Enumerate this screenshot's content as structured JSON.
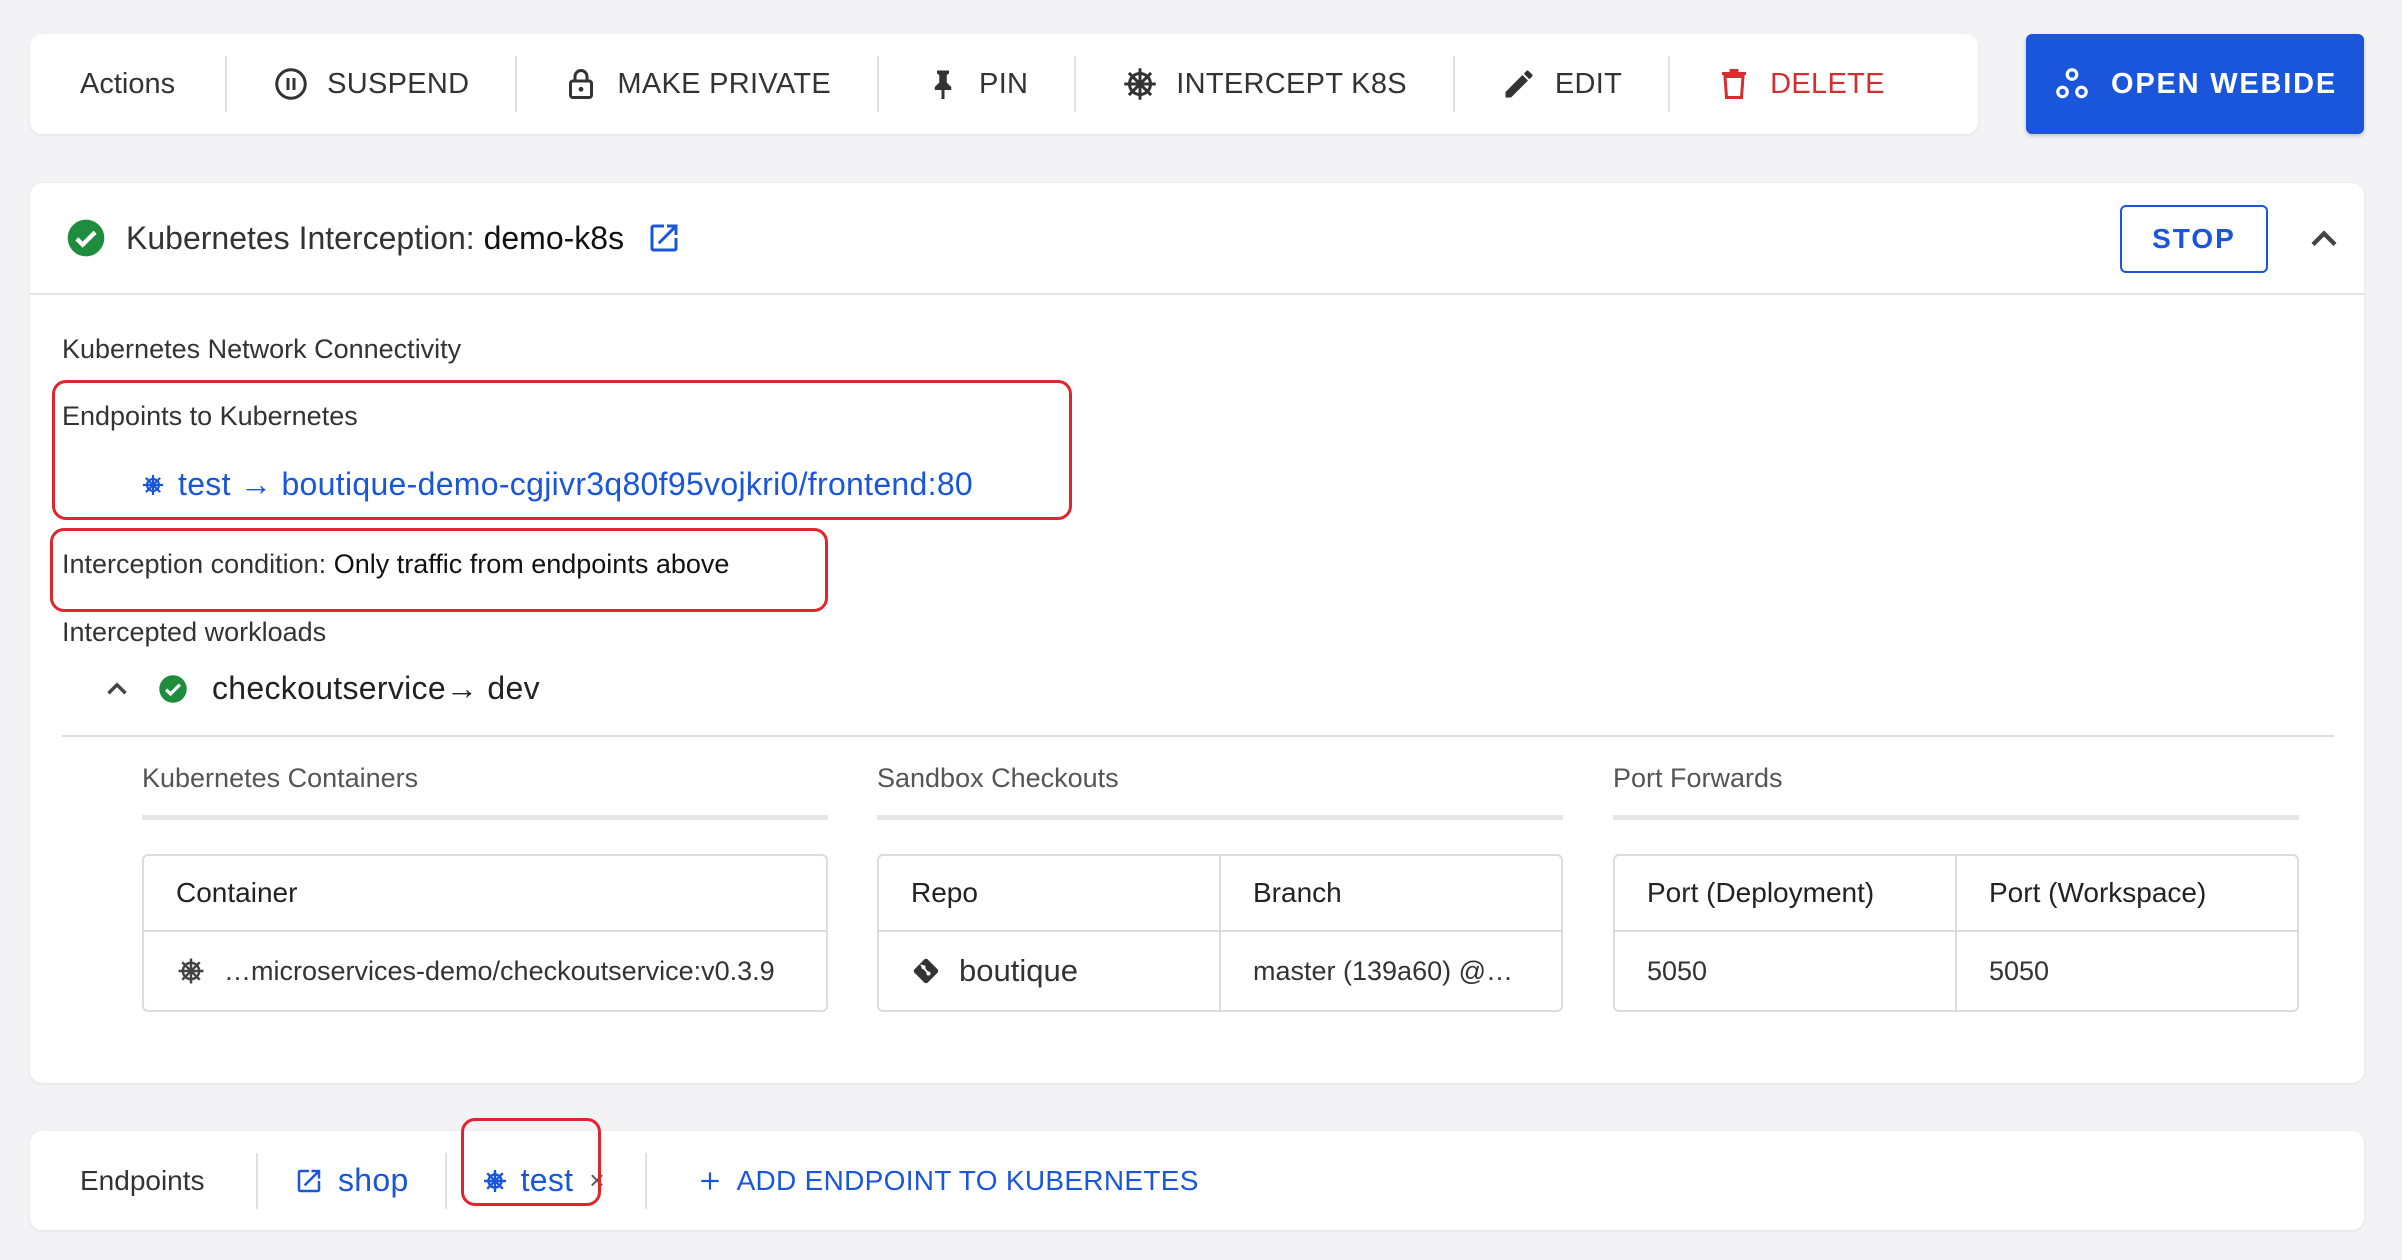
{
  "toolbar": {
    "label": "Actions",
    "buttons": [
      {
        "label": "SUSPEND",
        "icon": "pause-circle-icon"
      },
      {
        "label": "MAKE PRIVATE",
        "icon": "lock-icon"
      },
      {
        "label": "PIN",
        "icon": "pin-icon"
      },
      {
        "label": "INTERCEPT K8S",
        "icon": "kubernetes-helm-icon"
      },
      {
        "label": "EDIT",
        "icon": "pencil-icon"
      },
      {
        "label": "DELETE",
        "icon": "trash-icon"
      }
    ],
    "open_webide": "OPEN WEBIDE"
  },
  "interception": {
    "title_prefix": "Kubernetes Interception: ",
    "title_name": "demo-k8s",
    "stop_label": "STOP",
    "network_heading": "Kubernetes Network Connectivity",
    "endpoints_heading": "Endpoints to Kubernetes",
    "endpoint_link": "test → boutique-demo-cgjivr3q80f95vojkri0/frontend:80",
    "condition_label": "Interception condition: ",
    "condition_value": "Only traffic from endpoints above",
    "workloads_heading": "Intercepted workloads",
    "workload_name": "checkoutservice→ dev",
    "sections": {
      "containers": {
        "title": "Kubernetes Containers",
        "headers": [
          "Container"
        ],
        "rows": [
          [
            "…microservices-demo/checkoutservice:v0.3.9"
          ]
        ]
      },
      "checkouts": {
        "title": "Sandbox Checkouts",
        "headers": [
          "Repo",
          "Branch"
        ],
        "rows": [
          [
            "boutique",
            "master (139a60) @…"
          ]
        ]
      },
      "ports": {
        "title": "Port Forwards",
        "headers": [
          "Port (Deployment)",
          "Port (Workspace)"
        ],
        "rows": [
          [
            "5050",
            "5050"
          ]
        ]
      }
    }
  },
  "endpoints_bar": {
    "label": "Endpoints",
    "items": [
      {
        "label": "shop",
        "icon": "external-link-icon"
      },
      {
        "label": "test",
        "icon": "kubernetes-icon"
      }
    ],
    "close_glyph": "×",
    "add_label": "ADD ENDPOINT TO KUBERNETES"
  },
  "colors": {
    "accent": "#1a56db",
    "danger": "#d32f2f",
    "success": "#1e8e3e",
    "highlight": "#e0252f"
  }
}
